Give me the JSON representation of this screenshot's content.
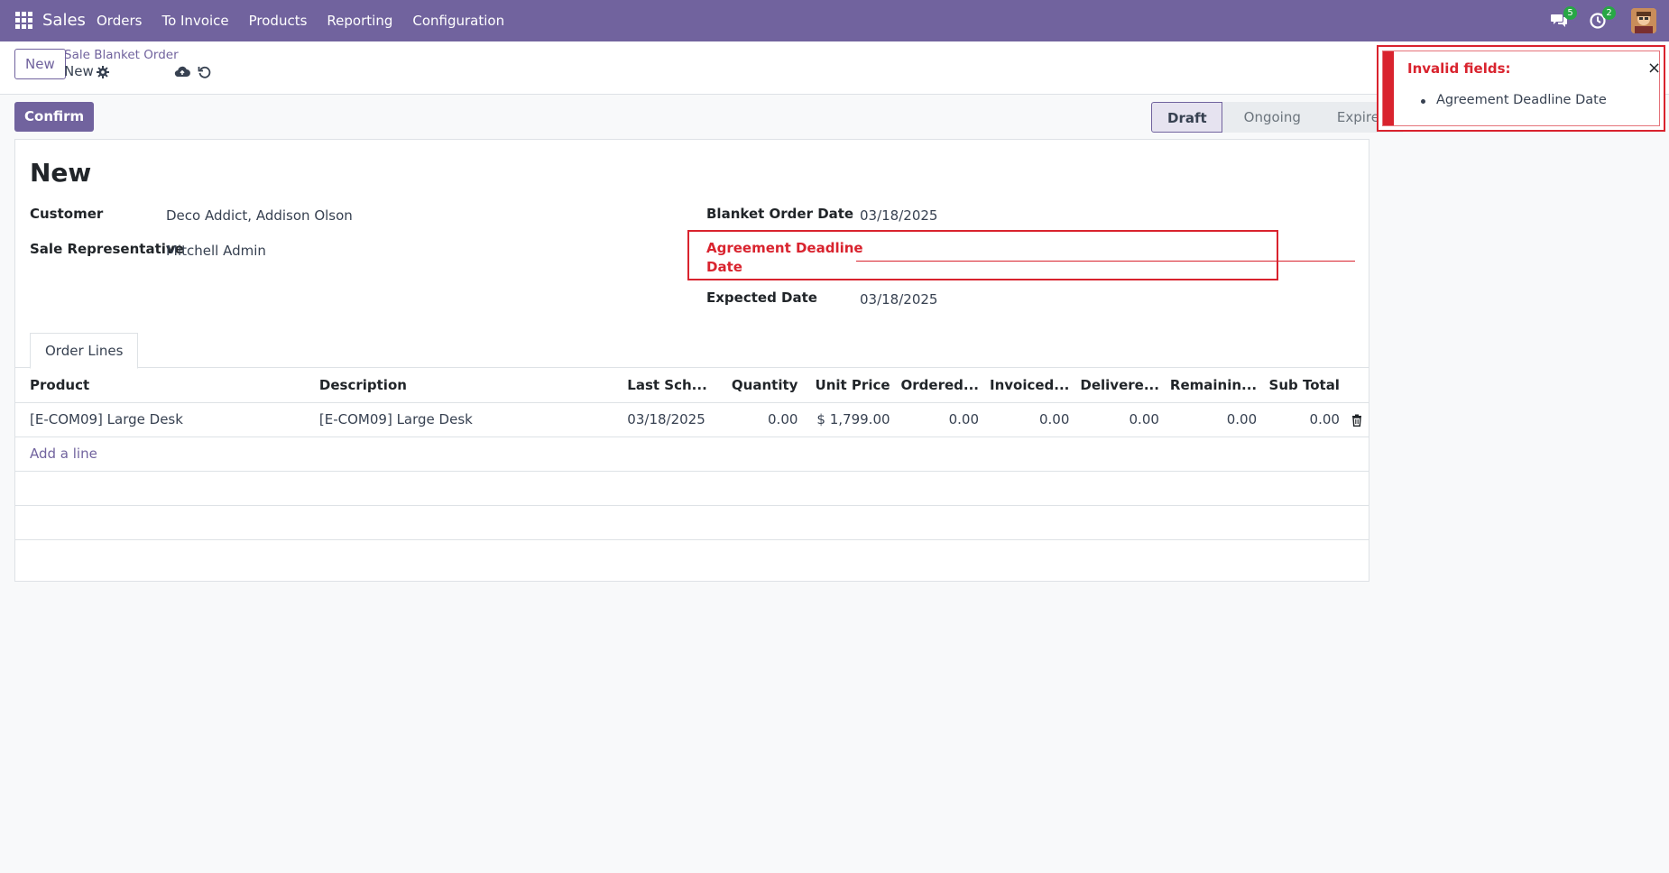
{
  "navbar": {
    "brand": "Sales",
    "menu": [
      "Orders",
      "To Invoice",
      "Products",
      "Reporting",
      "Configuration"
    ],
    "messages_badge": "5",
    "activities_badge": "2"
  },
  "control_panel": {
    "new_button": "New",
    "breadcrumb_parent": "Sale Blanket Order",
    "breadcrumb_current": "New"
  },
  "actions": {
    "confirm_button": "Confirm"
  },
  "statusbar": {
    "stages": [
      "Draft",
      "Ongoing",
      "Expired"
    ],
    "active": "Draft"
  },
  "form": {
    "title": "New",
    "customer_label": "Customer",
    "customer_value": "Deco Addict, Addison Olson",
    "salesrep_label": "Sale Representative",
    "salesrep_value": "Mitchell Admin",
    "order_date_label": "Blanket Order Date",
    "order_date_value": "03/18/2025",
    "deadline_label_line1": "Agreement Deadline",
    "deadline_label_line2": "Date",
    "deadline_value": "",
    "expected_label": "Expected Date",
    "expected_value": "03/18/2025"
  },
  "tabs": [
    "Order Lines"
  ],
  "table": {
    "headers": [
      "Product",
      "Description",
      "Last Sch...",
      "Quantity",
      "Unit Price",
      "Ordered...",
      "Invoiced...",
      "Delivere...",
      "Remainin...",
      "Sub Total"
    ],
    "rows": [
      [
        "[E-COM09] Large Desk",
        "[E-COM09] Large Desk",
        "03/18/2025",
        "0.00",
        "$ 1,799.00",
        "0.00",
        "0.00",
        "0.00",
        "0.00",
        "0.00"
      ]
    ],
    "add_line": "Add a line"
  },
  "notification": {
    "title": "Invalid fields:",
    "items": [
      "Agreement Deadline Date"
    ],
    "close": "×"
  },
  "colors": {
    "brand": "#71639e",
    "danger": "#d9232e",
    "badge": "#28a745"
  }
}
